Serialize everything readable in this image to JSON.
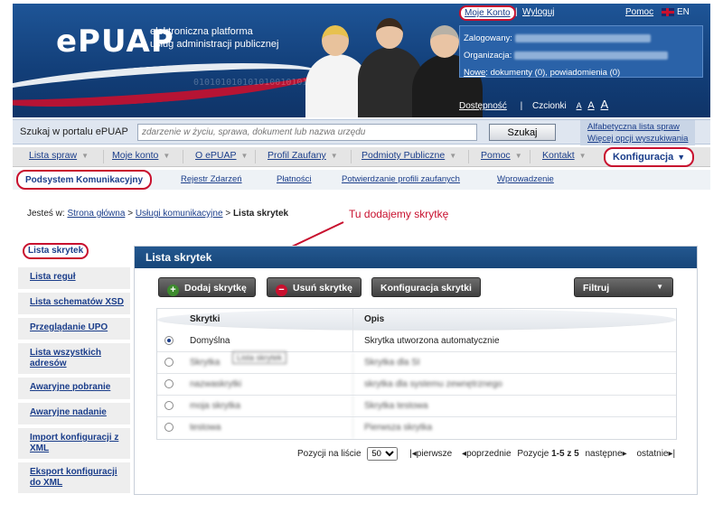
{
  "brand": {
    "logo": "ePUAP",
    "subtitle_line1": "elektroniczna platforma",
    "subtitle_line2": "usług administracji publicznej",
    "binary": "010101010101010010101"
  },
  "topbar": {
    "moje_konto": "Moje Konto",
    "separator": "|",
    "wyloguj": "Wyloguj",
    "pomoc": "Pomoc",
    "lang": "EN"
  },
  "userbox": {
    "logged_label": "Zalogowany:",
    "org_label": "Organizacja:",
    "new_link": "Nowe",
    "new_text": ": dokumenty (0), powiadomienia (0)"
  },
  "access": {
    "dostepnosc": "Dostępność",
    "separator": "|",
    "czcionki": "Czcionki",
    "a1": "A",
    "a2": "A",
    "a3": "A"
  },
  "search": {
    "label": "Szukaj w portalu ePUAP",
    "placeholder": "zdarzenie w życiu, sprawa, dokument lub nazwa urzędu",
    "button": "Szukaj",
    "link1": "Alfabetyczna lista spraw",
    "link2": "Więcej opcji wyszukiwania"
  },
  "menu": {
    "items": [
      "Lista spraw",
      "Moje konto",
      "O ePUAP",
      "Profil Zaufany",
      "Podmioty Publiczne",
      "Pomoc",
      "Kontakt"
    ],
    "active": "Konfiguracja"
  },
  "submenu": {
    "active": "Podsystem Komunikacyjny",
    "items": [
      "Rejestr Zdarzeń",
      "Płatności",
      "Potwierdzanie profili zaufanych",
      "Wprowadzenie"
    ]
  },
  "breadcrumb": {
    "prefix": "Jesteś w:",
    "home": "Strona główna",
    "sep": ">",
    "middle": "Usługi komunikacyjne",
    "current": "Lista skrytek"
  },
  "annotation": "Tu dodajemy skrytkę",
  "sidebar": {
    "active": "Lista skrytek",
    "items": [
      "Lista reguł",
      "Lista schematów XSD",
      "Przeglądanie UPO",
      "Lista wszystkich adresów",
      "Awaryjne pobranie",
      "Awaryjne nadanie",
      "Import konfiguracji z XML",
      "Eksport konfiguracji do XML"
    ]
  },
  "panel": {
    "title": "Lista skrytek",
    "add": "Dodaj skrytkę",
    "remove": "Usuń skrytkę",
    "config": "Konfiguracja skrytki",
    "filter": "Filtruj",
    "tooltip": "Lista skrytek",
    "columns": [
      "Skrytki",
      "Opis"
    ],
    "rows": [
      {
        "name": "Domyślna",
        "desc": "Skrytka utworzona automatycznie",
        "selected": true
      },
      {
        "name": "Skrytka",
        "desc": "Skrytka dla SI",
        "selected": false
      },
      {
        "name": "nazwaskrytki",
        "desc": "skrytka dla systemu zewnętrznego",
        "selected": false
      },
      {
        "name": "moja skrytka",
        "desc": "Skrytka testowa",
        "selected": false
      },
      {
        "name": "testowa",
        "desc": "Pierwsza skrytka",
        "selected": false
      }
    ]
  },
  "pager": {
    "per_page_label": "Pozycji na liście",
    "per_page": "50",
    "first": "pierwsze",
    "prev": "poprzednie",
    "range_label": "Pozycje",
    "range": "1-5 z 5",
    "next": "następne",
    "last": "ostatnie"
  },
  "colors": {
    "brand_blue": "#1e5597",
    "highlight_red": "#c8102e",
    "link": "#1a3d8a"
  }
}
